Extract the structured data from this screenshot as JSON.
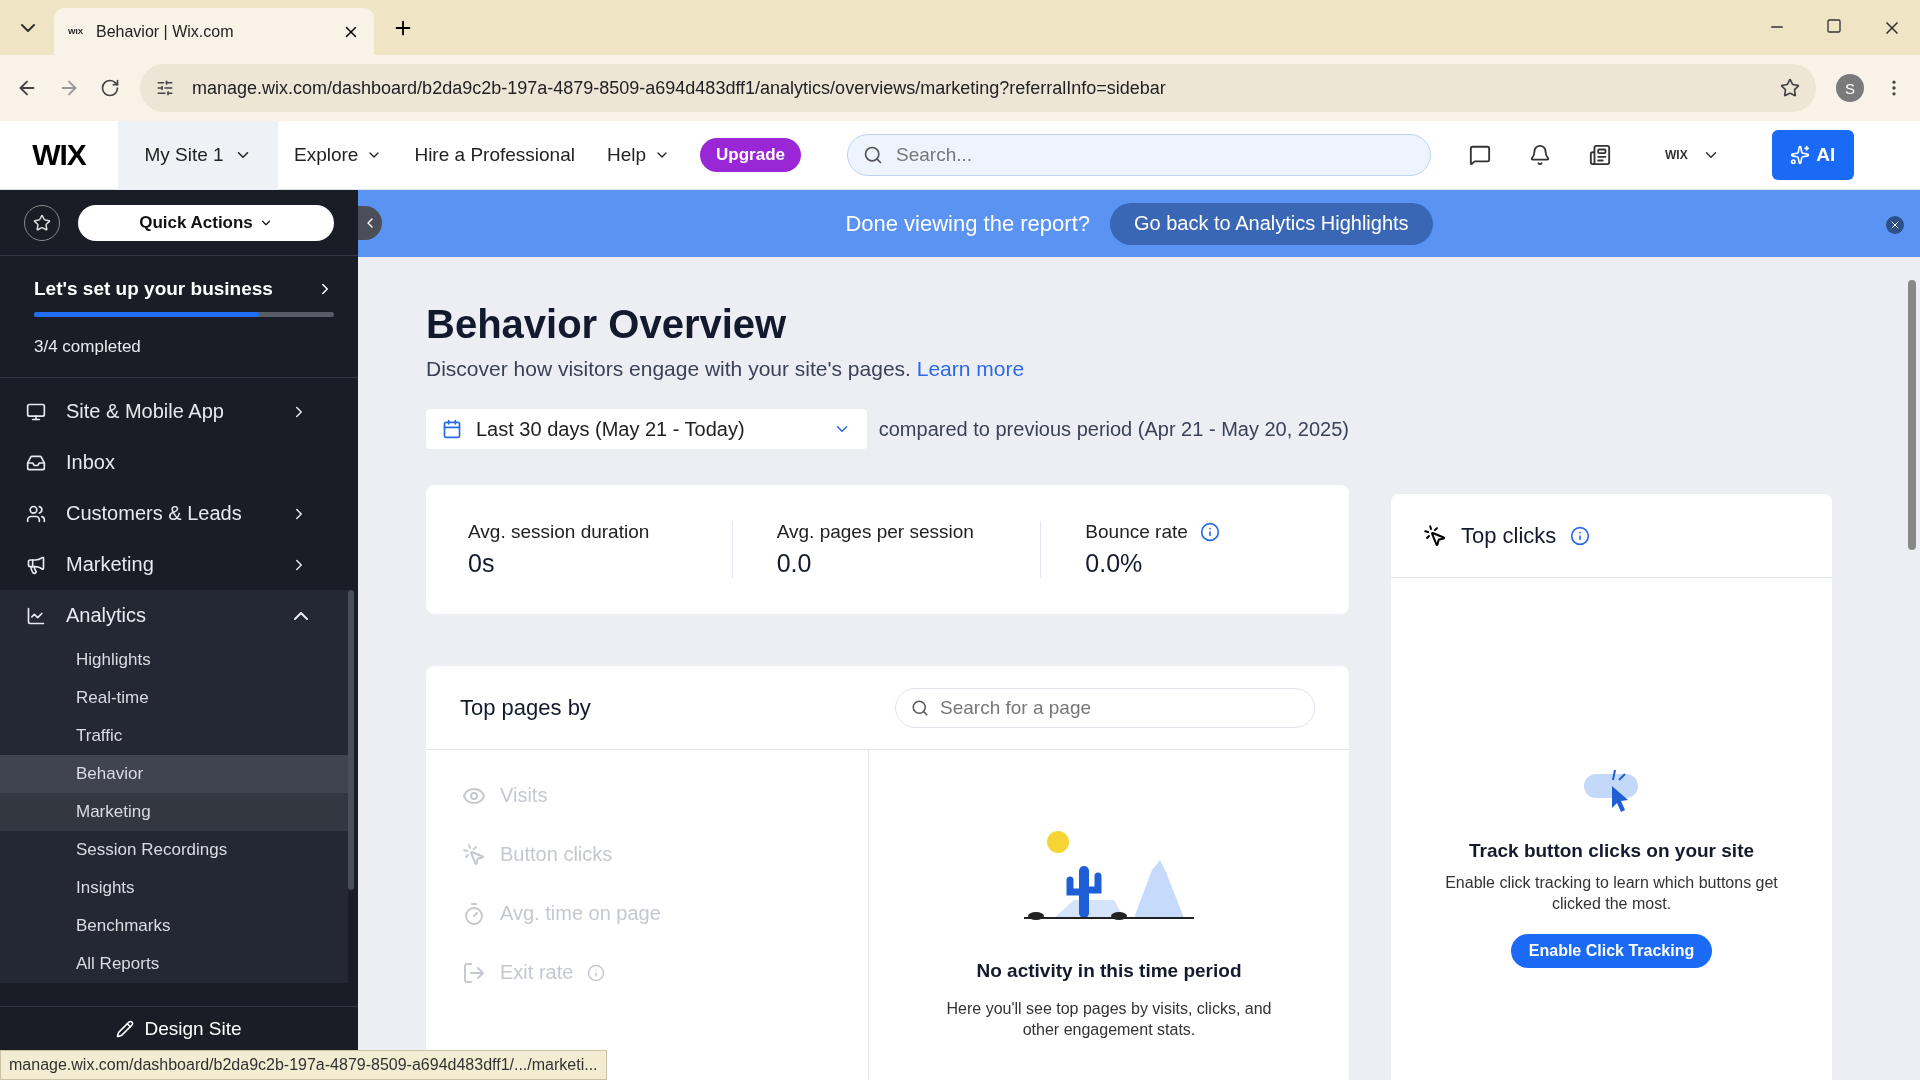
{
  "browser": {
    "tab": {
      "favicon_text": "WIX",
      "title": "Behavior | Wix.com"
    },
    "url": "manage.wix.com/dashboard/b2da9c2b-197a-4879-8509-a694d483dff1/analytics/overviews/marketing?referralInfo=sidebar",
    "profile": "S",
    "status_url": "manage.wix.com/dashboard/b2da9c2b-197a-4879-8509-a694d483dff1/.../marketi..."
  },
  "header": {
    "logo": "WIX",
    "site": "My Site 1",
    "nav": [
      {
        "label": "Explore",
        "caret": true
      },
      {
        "label": "Hire a Professional",
        "caret": false
      },
      {
        "label": "Help",
        "caret": true
      }
    ],
    "upgrade": "Upgrade",
    "search": {
      "placeholder": "Search..."
    },
    "account": "WIX",
    "ai": "AI"
  },
  "banner": {
    "text": "Done viewing the report?",
    "button": "Go back to Analytics Highlights"
  },
  "sidebar": {
    "quick_actions": "Quick Actions",
    "setup": {
      "title": "Let's set up your business",
      "level": 0.75,
      "progress": "3/4 completed"
    },
    "items": [
      {
        "label": "Site & Mobile App",
        "kind": "group",
        "expanded": false
      },
      {
        "label": "Inbox",
        "kind": "link"
      },
      {
        "label": "Customers & Leads",
        "kind": "group",
        "expanded": false
      },
      {
        "label": "Marketing",
        "kind": "group",
        "expanded": false
      },
      {
        "label": "Analytics",
        "kind": "group",
        "expanded": true,
        "children": [
          {
            "label": "Highlights",
            "selected": false,
            "hovered": false
          },
          {
            "label": "Real-time",
            "selected": false,
            "hovered": false
          },
          {
            "label": "Traffic",
            "selected": false,
            "hovered": false
          },
          {
            "label": "Behavior",
            "selected": true,
            "hovered": false
          },
          {
            "label": "Marketing",
            "selected": false,
            "hovered": true
          },
          {
            "label": "Session Recordings",
            "selected": false,
            "hovered": false
          },
          {
            "label": "Insights",
            "selected": false,
            "hovered": false
          },
          {
            "label": "Benchmarks",
            "selected": false,
            "hovered": false
          },
          {
            "label": "All Reports",
            "selected": false,
            "hovered": false
          }
        ]
      }
    ],
    "design_site": "Design Site"
  },
  "page": {
    "title": "Behavior Overview",
    "subtitle": "Discover how visitors engage with your site's pages.",
    "learn_more": "Learn more",
    "date_range": "Last 30 days (May 21 - Today)",
    "comparison": "compared to previous period (Apr 21 - May 20, 2025)",
    "stats": [
      {
        "label": "Avg. session duration",
        "value": "0s",
        "info": false
      },
      {
        "label": "Avg. pages per session",
        "value": "0.0",
        "info": false
      },
      {
        "label": "Bounce rate",
        "value": "0.0%",
        "info": true
      }
    ],
    "top_pages": {
      "title": "Top pages by",
      "search": {
        "placeholder": "Search for a page"
      },
      "metrics": [
        {
          "label": "Visits",
          "kind": "eye",
          "disabled": true,
          "info": false
        },
        {
          "label": "Button clicks",
          "kind": "click",
          "disabled": true,
          "info": false
        },
        {
          "label": "Avg. time on page",
          "kind": "timer",
          "disabled": true,
          "info": false
        },
        {
          "label": "Exit rate",
          "kind": "exit",
          "disabled": true,
          "info": true
        }
      ],
      "empty_title": "No activity in this time period",
      "empty_text": "Here you'll see top pages by visits, clicks, and other engagement stats."
    },
    "top_clicks": {
      "title": "Top clicks",
      "info": true,
      "empty_title": "Track button clicks on your site",
      "empty_text": "Enable click tracking to learn which buttons get clicked the most.",
      "button": "Enable Click Tracking"
    }
  }
}
